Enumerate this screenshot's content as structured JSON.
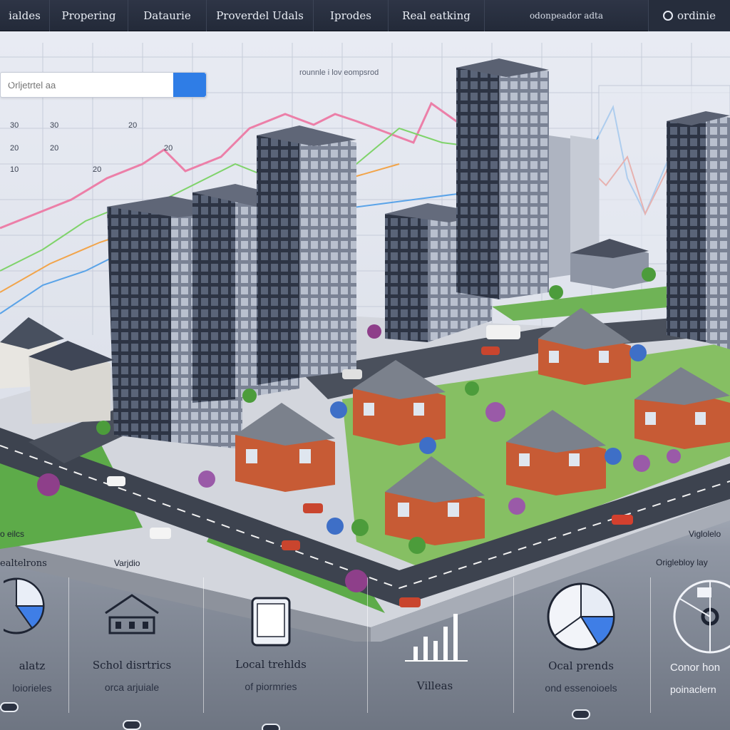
{
  "nav": {
    "items": [
      "ialdes",
      "Propering",
      "Dataurie",
      "Proverdel Udals",
      "Iprodes",
      "Real eatking",
      "odonpeador adta"
    ],
    "right_label": "ordinie"
  },
  "dashboard": {
    "search_placeholder": "Orljetrtel aa",
    "chart_title": "rounnle i lov eompsrod",
    "y_labels": [
      "30",
      "30",
      "20",
      "20",
      "10",
      "20",
      "20",
      "20"
    ],
    "accent": "#2f7de6"
  },
  "captions": {
    "top_left": "o eilcs",
    "top_right": "Viglolelo",
    "right_sub": "Origlebloy lay"
  },
  "features": [
    {
      "title": "alatz",
      "subtitle": "loiorieles",
      "icon": "pie-chart-icon"
    },
    {
      "title": "Schol disrtrics",
      "subtitle": "orca arjuiale",
      "icon": "house-icon",
      "heading": "Varjdio"
    },
    {
      "title": "Local trehlds",
      "subtitle": "of piormries",
      "icon": "tablet-icon"
    },
    {
      "title": "Villeas",
      "subtitle": "",
      "icon": "bar-chart-icon"
    },
    {
      "title": "Ocal prends",
      "subtitle": "ond essenoioels",
      "icon": "pie-chart-icon"
    },
    {
      "title": "Conor hon",
      "subtitle": "poinaclern",
      "icon": "disc-chart-icon"
    }
  ],
  "left_caption": "ealtelrons"
}
